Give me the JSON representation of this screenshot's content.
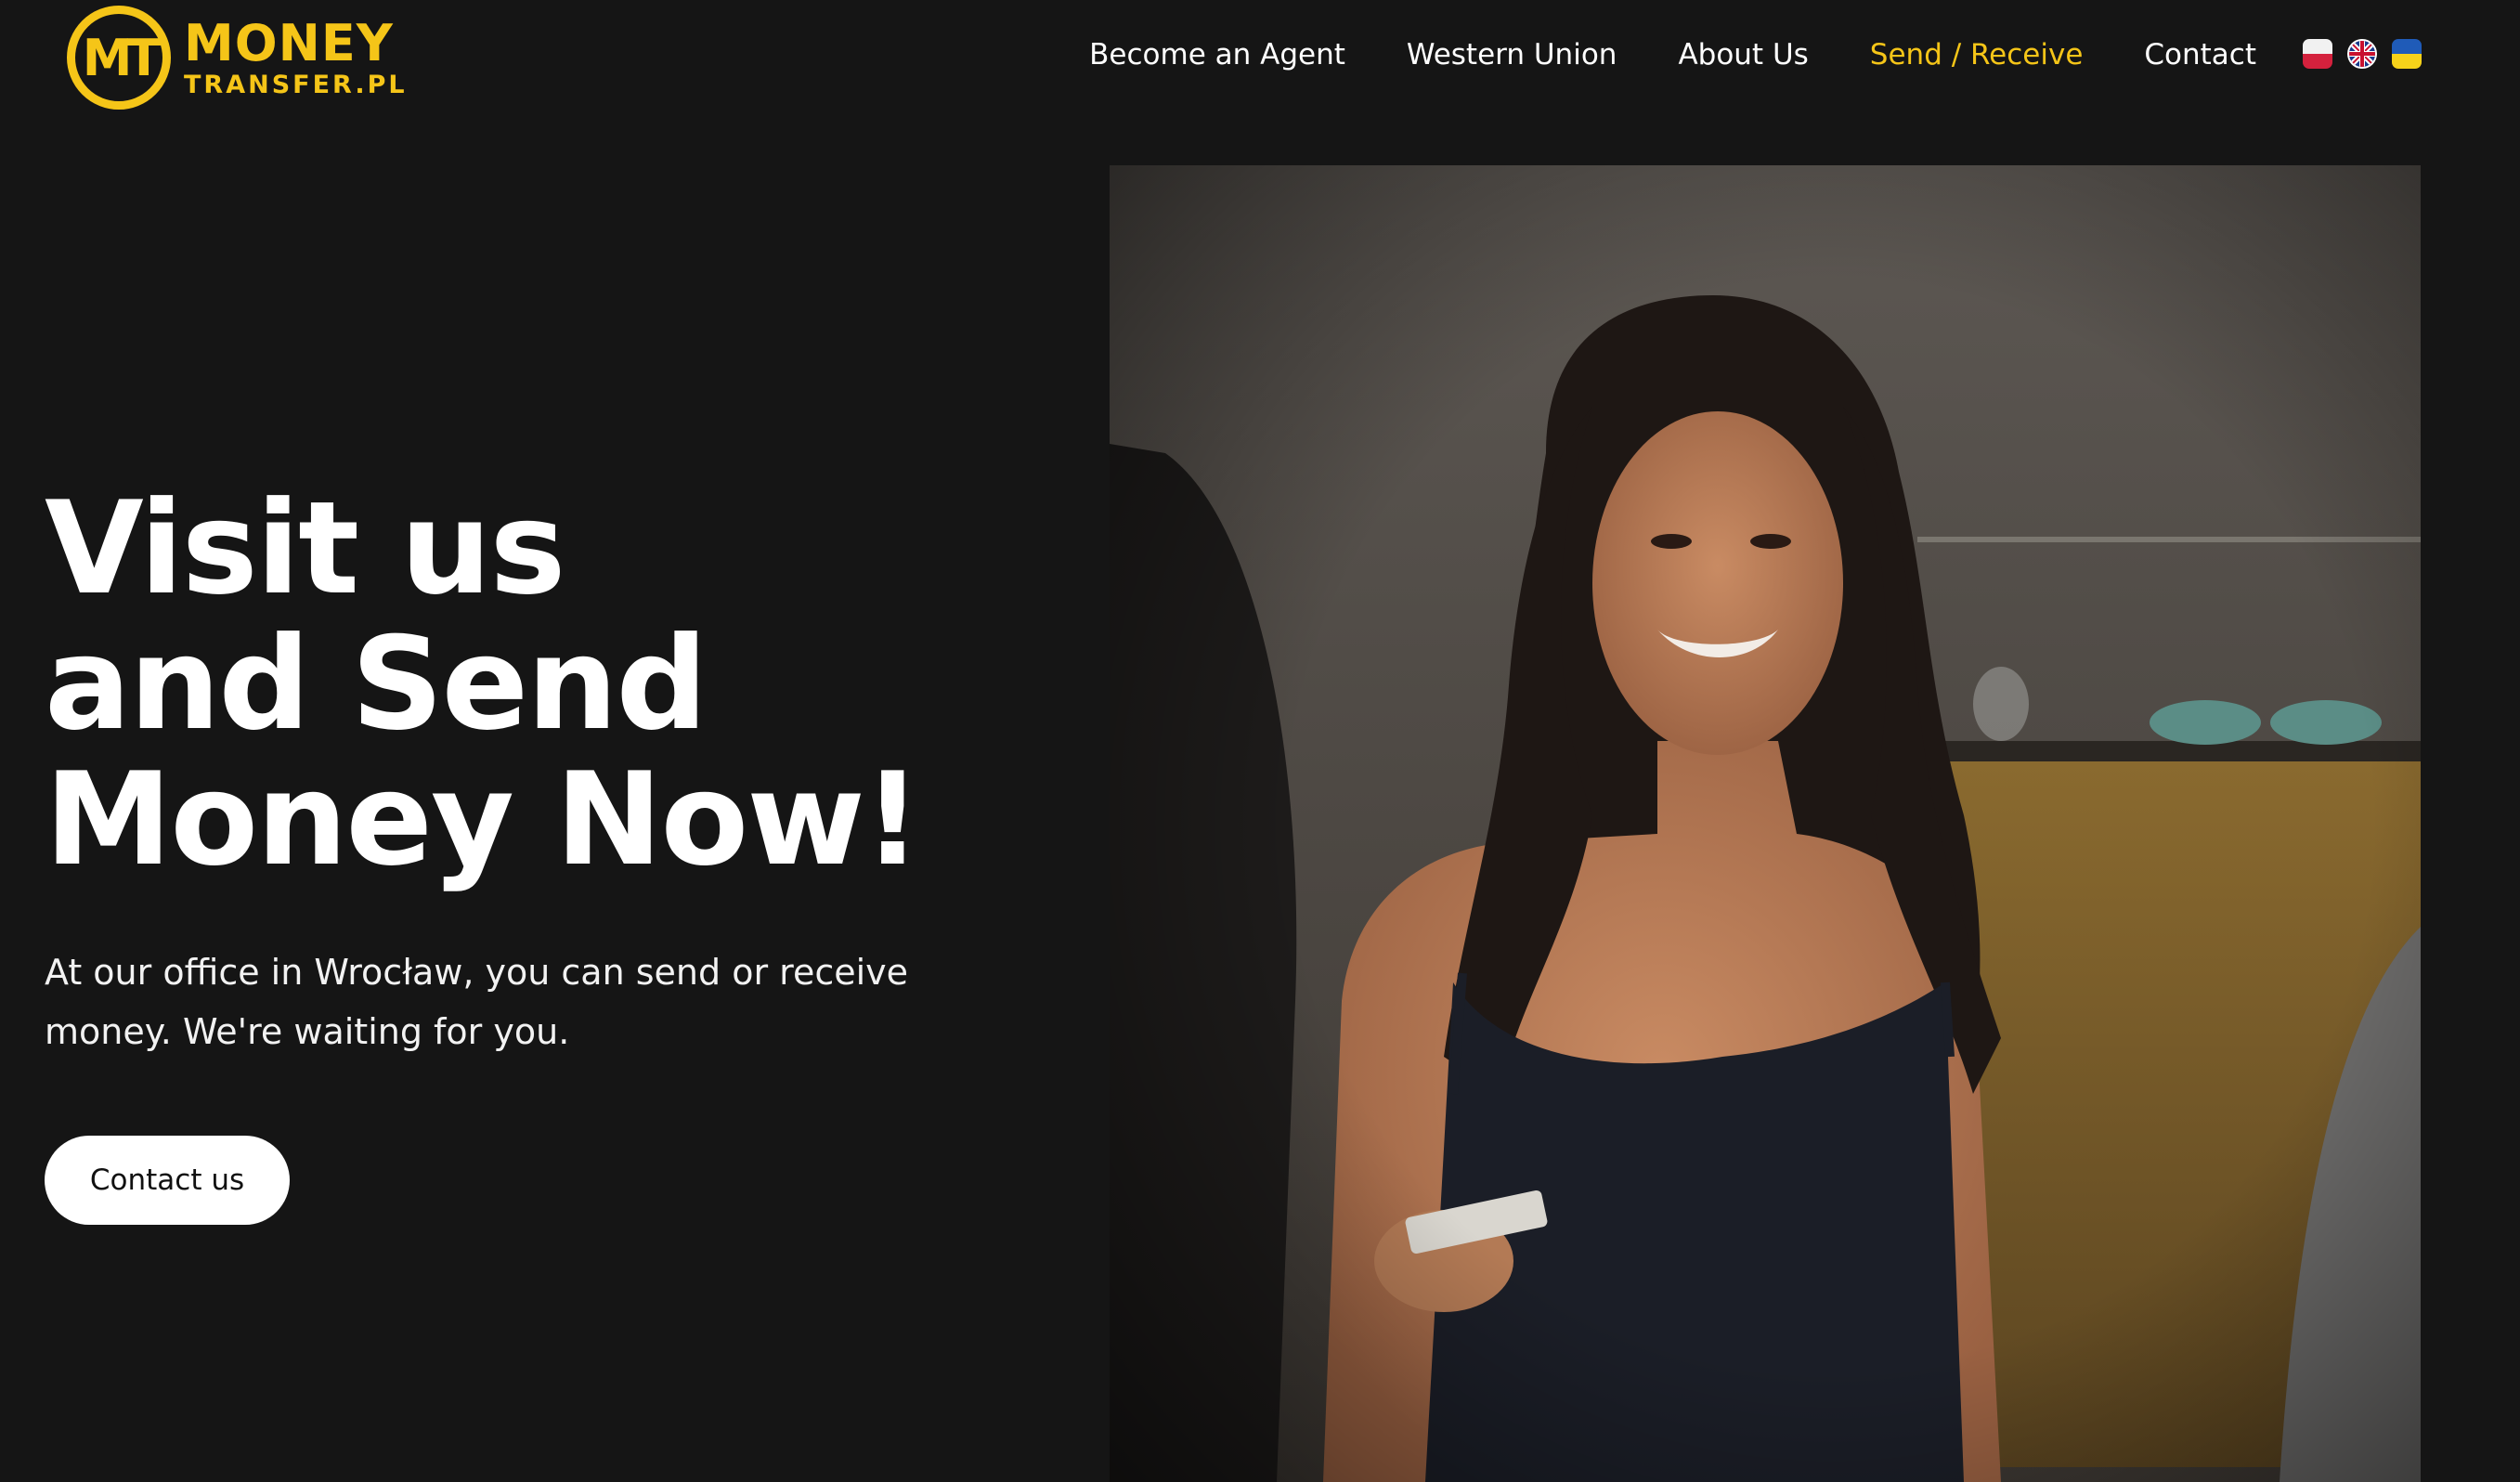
{
  "brand": {
    "logo_monogram": "MT",
    "name_line1": "MONEY",
    "name_line2": "TRANSFER.PL",
    "accent_color": "#f5c518"
  },
  "nav": {
    "items": [
      {
        "label": "Become an Agent",
        "active": false
      },
      {
        "label": "Western Union",
        "active": false
      },
      {
        "label": "About Us",
        "active": false
      },
      {
        "label": "Send / Receive",
        "active": true
      },
      {
        "label": "Contact",
        "active": false
      }
    ],
    "languages": [
      "pl-flag-icon",
      "uk-flag-icon",
      "ua-flag-icon"
    ]
  },
  "hero": {
    "title_lines": [
      "Visit us",
      "and Send",
      "Money Now!"
    ],
    "subtitle": "At our office in Wrocław, you can send or receive money. We're waiting for you.",
    "cta_label": "Contact us"
  },
  "colors": {
    "background": "#151515",
    "text": "#ffffff",
    "accent": "#f5c518"
  }
}
